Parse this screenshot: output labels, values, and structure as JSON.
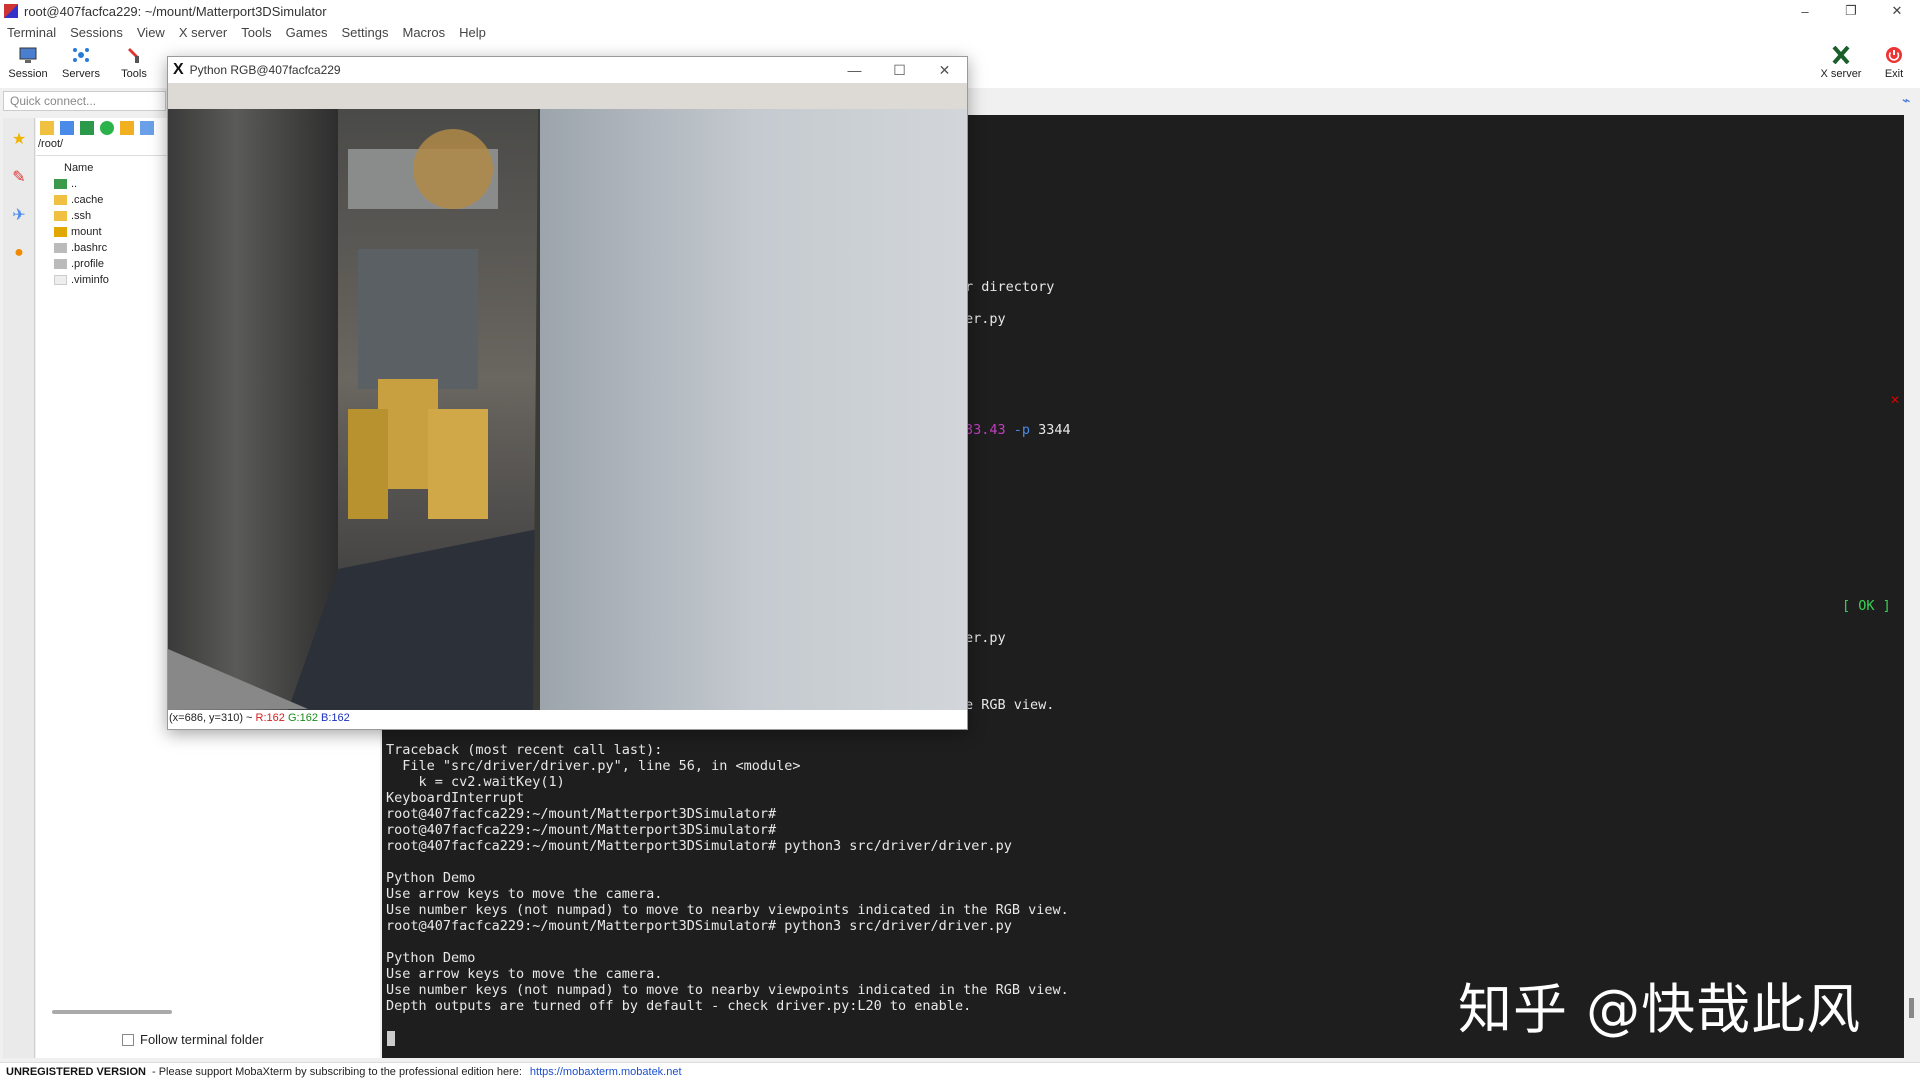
{
  "window": {
    "title": "root@407facfca229: ~/mount/Matterport3DSimulator",
    "controls": [
      "–",
      "❐",
      "✕"
    ]
  },
  "menu": [
    "Terminal",
    "Sessions",
    "View",
    "X server",
    "Tools",
    "Games",
    "Settings",
    "Macros",
    "Help"
  ],
  "toolbar": {
    "session": "Session",
    "servers": "Servers",
    "tools": "Tools",
    "xserver": "X server",
    "exit": "Exit"
  },
  "quick_connect": {
    "placeholder": "Quick connect..."
  },
  "sftp": {
    "path": "/root/",
    "column": "Name",
    "files": [
      {
        "name": "..",
        "icon": "parent-folder-icon"
      },
      {
        "name": ".cache",
        "icon": "folder-icon"
      },
      {
        "name": ".ssh",
        "icon": "folder-icon"
      },
      {
        "name": "mount",
        "icon": "folder-icon"
      },
      {
        "name": ".bashrc",
        "icon": "file-icon"
      },
      {
        "name": ".profile",
        "icon": "file-icon"
      },
      {
        "name": ".viminfo",
        "icon": "file-icon"
      }
    ],
    "follow_label": "Follow terminal folder"
  },
  "terminal": {
    "partial": {
      "l1": "r directory",
      "l2": "er.py",
      "l3a": "33.43",
      "l3b": " -p",
      "l3c": " 3344",
      "l4": "er.py",
      "l5": "e RGB view.",
      "ok": "[ OK ]"
    },
    "lines": [
      "Traceback (most recent call last):",
      "  File \"src/driver/driver.py\", line 56, in <module>",
      "    k = cv2.waitKey(1)",
      "KeyboardInterrupt",
      "root@407facfca229:~/mount/Matterport3DSimulator#",
      "root@407facfca229:~/mount/Matterport3DSimulator#",
      "root@407facfca229:~/mount/Matterport3DSimulator# python3 src/driver/driver.py",
      "",
      "Python Demo",
      "Use arrow keys to move the camera.",
      "Use number keys (not numpad) to move to nearby viewpoints indicated in the RGB view.",
      "root@407facfca229:~/mount/Matterport3DSimulator# python3 src/driver/driver.py",
      "",
      "Python Demo",
      "Use arrow keys to move the camera.",
      "Use number keys (not numpad) to move to nearby viewpoints indicated in the RGB view.",
      "Depth outputs are turned off by default - check driver.py:L20 to enable."
    ]
  },
  "python_window": {
    "title": "Python RGB@407facfca229",
    "controls": [
      "—",
      "☐",
      "✕"
    ],
    "coords": "(x=686, y=310) ~",
    "r": "R:162",
    "g": "G:162",
    "b": "B:162"
  },
  "statusbar": {
    "unregistered": "UNREGISTERED VERSION",
    "message": "-  Please support MobaXterm by subscribing to the professional edition here:",
    "link": "https://mobaxterm.mobatek.net"
  },
  "watermark": "知乎 @快哉此风",
  "colors": {
    "terminal_bg": "#1e1e1e",
    "magenta": "#c040c0",
    "blue": "#4a8ae8",
    "ok_green": "#39d353"
  }
}
